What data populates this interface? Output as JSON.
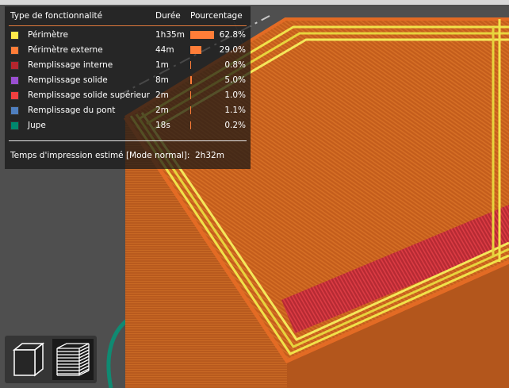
{
  "legend": {
    "headers": {
      "feature": "Type de fonctionnalité",
      "duration": "Durée",
      "percentage": "Pourcentage"
    },
    "rows": [
      {
        "name": "Périmètre",
        "time": "1h35m",
        "pct": "62.8%",
        "fraction": 0.628,
        "color": "#ffe94a"
      },
      {
        "name": "Périmètre externe",
        "time": "44m",
        "pct": "29.0%",
        "fraction": 0.29,
        "color": "#ff7d38"
      },
      {
        "name": "Remplissage interne",
        "time": "1m",
        "pct": "0.8%",
        "fraction": 0.008,
        "color": "#b3262e"
      },
      {
        "name": "Remplissage solide",
        "time": "8m",
        "pct": "5.0%",
        "fraction": 0.05,
        "color": "#9a4fd1"
      },
      {
        "name": "Remplissage solide supérieur",
        "time": "2m",
        "pct": "1.0%",
        "fraction": 0.01,
        "color": "#f04040"
      },
      {
        "name": "Remplissage du pont",
        "time": "2m",
        "pct": "1.1%",
        "fraction": 0.011,
        "color": "#4f7fbf"
      },
      {
        "name": "Jupe",
        "time": "18s",
        "pct": "0.2%",
        "fraction": 0.002,
        "color": "#00876d"
      }
    ],
    "footer_label": "Temps d'impression estimé [Mode normal]:",
    "footer_value": "2h32m"
  },
  "view_toolbar": {
    "buttons": [
      {
        "name": "view-3d",
        "icon": "cube-icon",
        "active": false
      },
      {
        "name": "view-layers",
        "icon": "layers-icon",
        "active": true
      }
    ]
  },
  "colors": {
    "background": "#4f4f4f",
    "perimeter": "#ffe94a",
    "external_perimeter": "#ff7d38",
    "top_solid_infill": "#f04040",
    "skirt": "#00876d",
    "bar": "#ff7d38"
  }
}
